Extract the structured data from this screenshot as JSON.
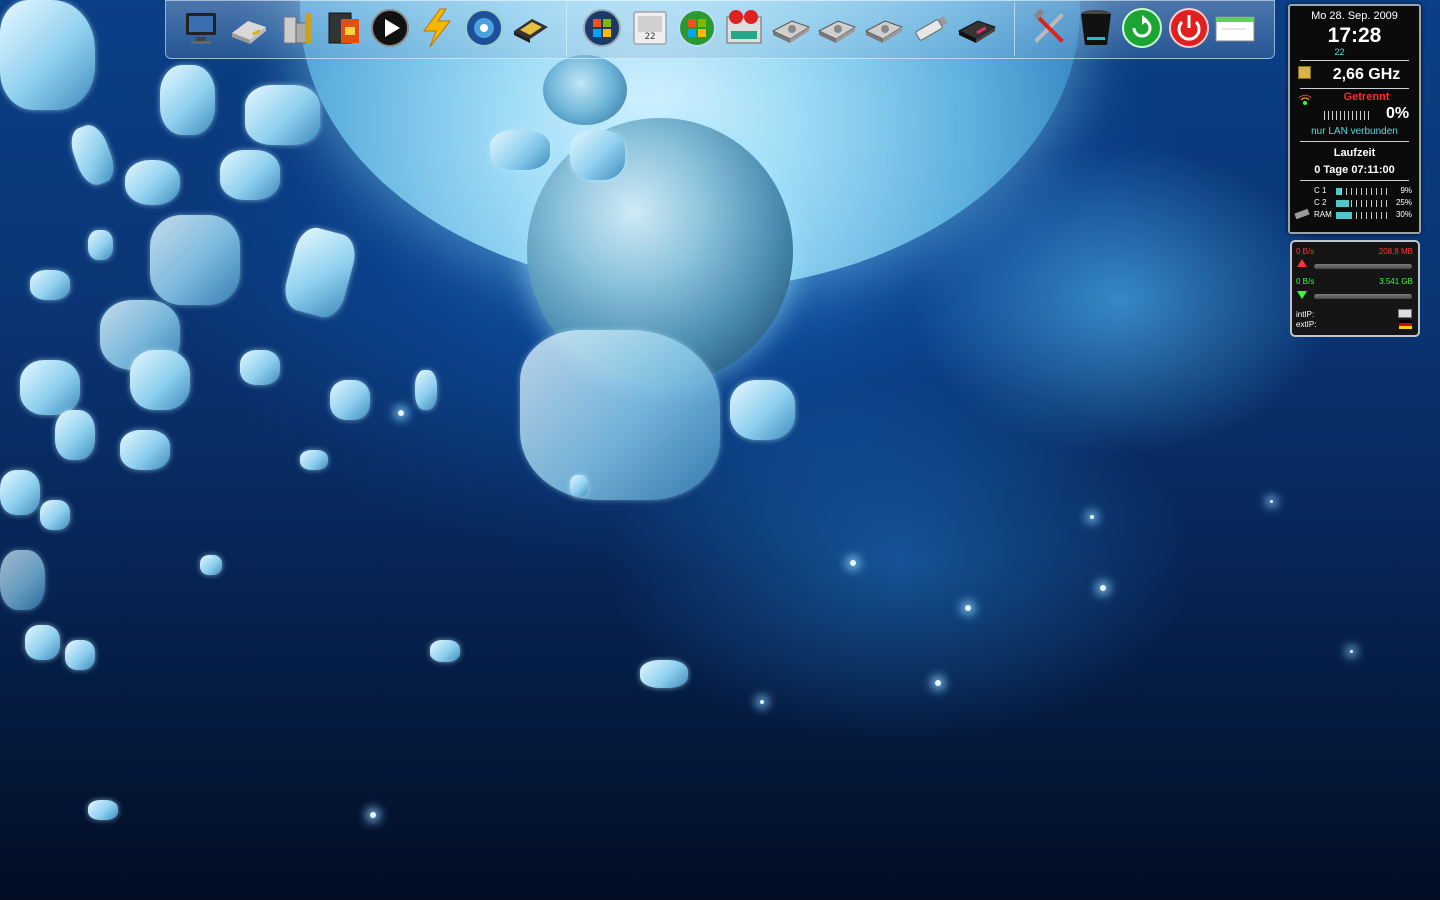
{
  "colors": {
    "gadget_bg": "#0b0b0b",
    "accent_green": "#33ff33",
    "accent_red": "#ff3333",
    "accent_cyan": "#55dcdc",
    "disconnected_red": "#ff2a2a"
  },
  "dock": {
    "icons": [
      {
        "name": "computer-icon"
      },
      {
        "name": "drive-icon"
      },
      {
        "name": "devices-icon"
      },
      {
        "name": "media-box-icon"
      },
      {
        "name": "play-icon"
      },
      {
        "name": "lightning-icon"
      },
      {
        "name": "media-player-icon"
      },
      {
        "name": "folder-box-icon"
      },
      {
        "name": "windows-start-icon"
      },
      {
        "name": "calendar-icon",
        "label": "22"
      },
      {
        "name": "windows-logo-icon"
      },
      {
        "name": "control-panel-icon"
      },
      {
        "name": "hard-drive-1-icon"
      },
      {
        "name": "hard-drive-2-icon"
      },
      {
        "name": "hard-drive-3-icon"
      },
      {
        "name": "usb-stick-icon"
      },
      {
        "name": "card-reader-icon"
      },
      {
        "name": "tools-icon"
      },
      {
        "name": "recycle-bin-icon"
      },
      {
        "name": "restart-icon"
      },
      {
        "name": "power-icon"
      },
      {
        "name": "window-icon"
      }
    ]
  },
  "system_gadget": {
    "date": "Mo 28. Sep. 2009",
    "time": "17:28",
    "seconds": "22",
    "cpu_speed": "2,66 GHz",
    "wifi_status": "Getrennt",
    "wifi_percent": "0%",
    "network_status": "nur LAN verbunden",
    "uptime_label": "Laufzeit",
    "uptime_value": "0 Tage 07:11:00",
    "bars": [
      {
        "label": "C 1",
        "value": 0.09,
        "percent": "9%"
      },
      {
        "label": "C 2",
        "value": 0.25,
        "percent": "25%"
      },
      {
        "label": "RAM",
        "value": 0.3,
        "percent": "30%"
      }
    ]
  },
  "network_gadget": {
    "upload_rate": "0 B/s",
    "upload_total": "208,8 MB",
    "download_rate": "0 B/s",
    "download_total": "3.541 GB",
    "int_ip_label": "intIP:",
    "ext_ip_label": "extIP:"
  }
}
